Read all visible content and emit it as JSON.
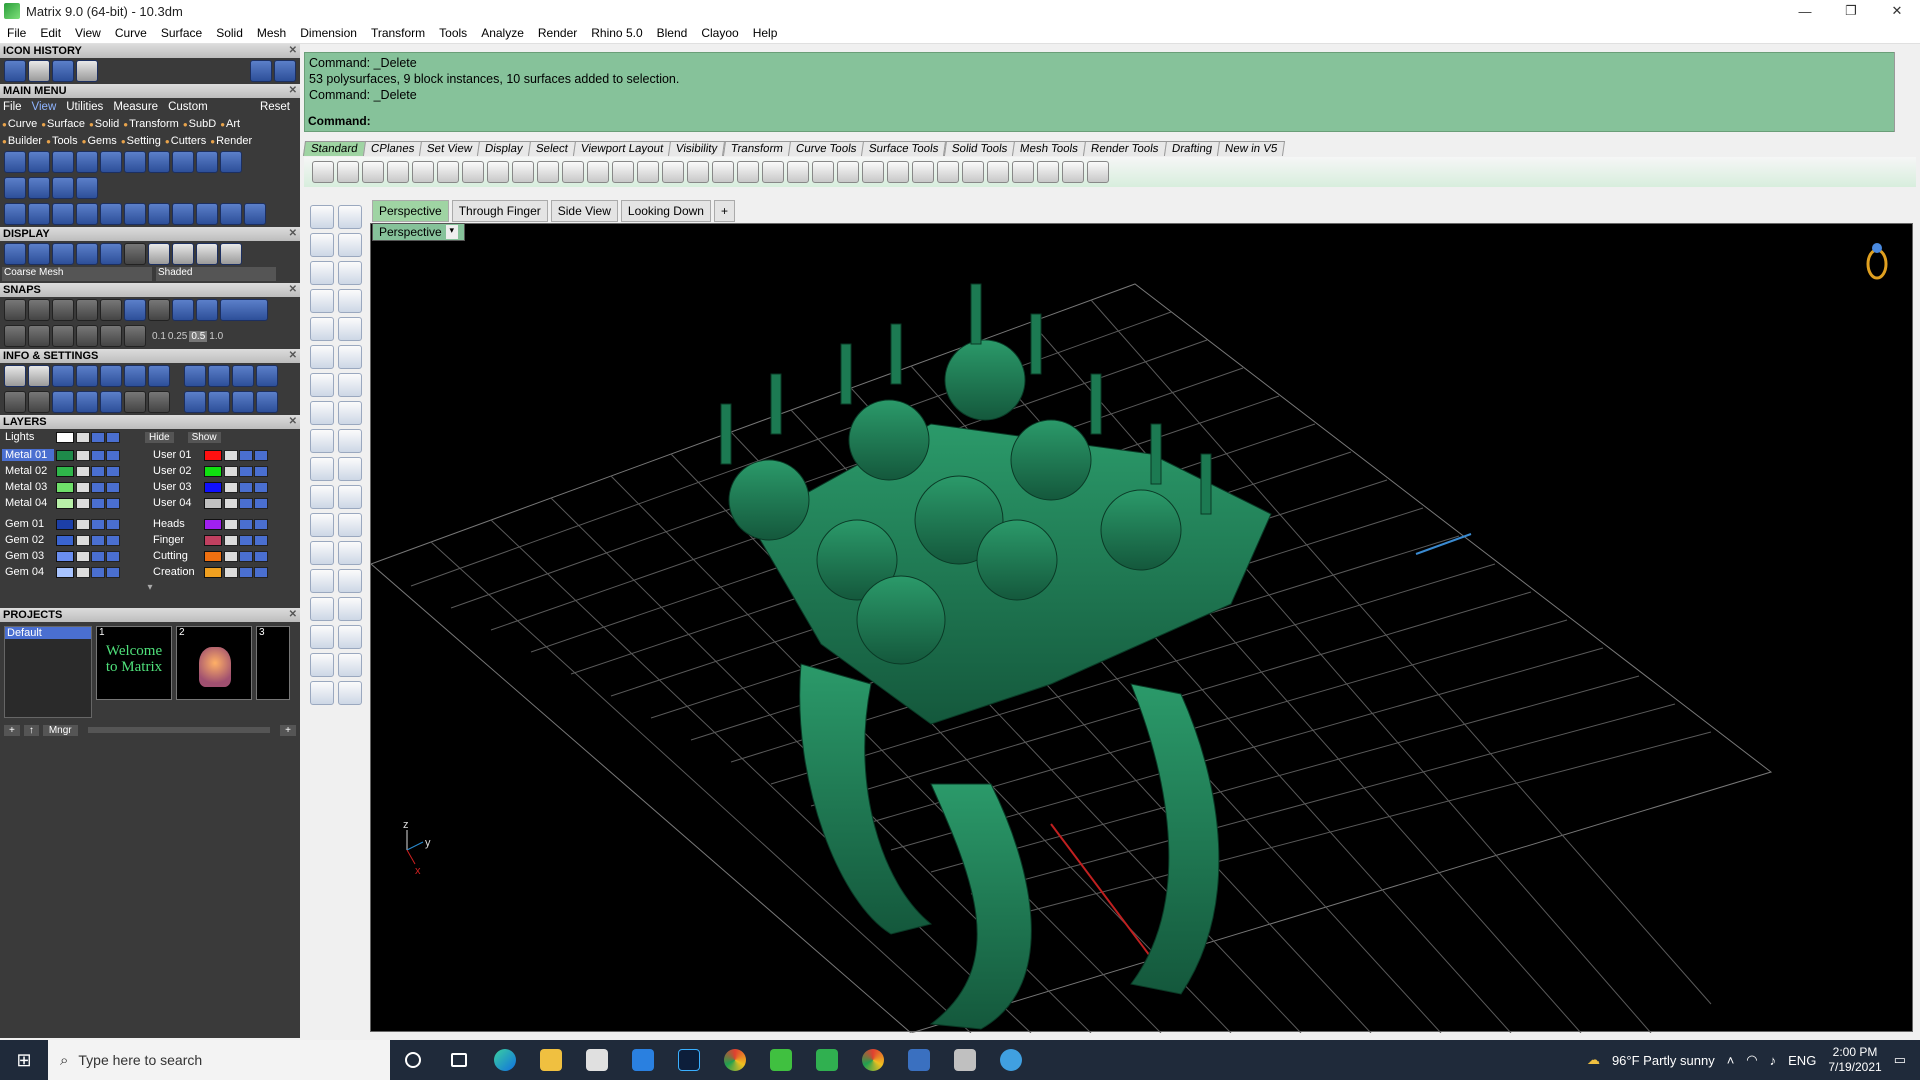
{
  "window": {
    "title": "Matrix 9.0 (64-bit) - 10.3dm",
    "min": "—",
    "max": "❐",
    "close": "✕"
  },
  "menu": [
    "File",
    "Edit",
    "View",
    "Curve",
    "Surface",
    "Solid",
    "Mesh",
    "Dimension",
    "Transform",
    "Tools",
    "Analyze",
    "Render",
    "Rhino 5.0",
    "Blend",
    "Clayoo",
    "Help"
  ],
  "panels": {
    "icon_history": "ICON HISTORY",
    "main_menu": "MAIN MENU",
    "main_menu_row1": [
      "File",
      "View",
      "Utilities",
      "Measure",
      "Custom",
      "Reset"
    ],
    "main_menu_row2": [
      "Curve",
      "Surface",
      "Solid",
      "Transform",
      "SubD",
      "Art"
    ],
    "main_menu_row3": [
      "Builder",
      "Tools",
      "Gems",
      "Setting",
      "Cutters",
      "Render"
    ],
    "display": "DISPLAY",
    "display_mesh": "Coarse Mesh",
    "display_shade": "Shaded",
    "snaps": "SNAPS",
    "snap_values": [
      "0.1",
      "0.25",
      "0.5",
      "1.0"
    ],
    "info": "INFO & SETTINGS",
    "layers": "LAYERS",
    "lights": "Lights",
    "hide": "Hide",
    "show": "Show",
    "layers_left": [
      {
        "name": "Metal 01",
        "color": "#1e8a4a"
      },
      {
        "name": "Metal 02",
        "color": "#2fb64a"
      },
      {
        "name": "Metal 03",
        "color": "#6fe06a"
      },
      {
        "name": "Metal 04",
        "color": "#b8f0a8"
      },
      {
        "name": "Gem 01",
        "color": "#1c3fa8"
      },
      {
        "name": "Gem 02",
        "color": "#3a64d0"
      },
      {
        "name": "Gem 03",
        "color": "#6a8ef0"
      },
      {
        "name": "Gem 04",
        "color": "#a8c4ff"
      }
    ],
    "layers_right": [
      {
        "name": "User 01",
        "color": "#ff1010"
      },
      {
        "name": "User 02",
        "color": "#10e010"
      },
      {
        "name": "User 03",
        "color": "#1010ff"
      },
      {
        "name": "User 04",
        "color": "#c0c0c0"
      },
      {
        "name": "Heads",
        "color": "#a020f0"
      },
      {
        "name": "Finger",
        "color": "#c04060"
      },
      {
        "name": "Cutting",
        "color": "#f07010"
      },
      {
        "name": "Creation",
        "color": "#f0a020"
      }
    ],
    "projects": "PROJECTS",
    "project_default": "Default",
    "thumb1_num": "1",
    "thumb1_text": "Welcome to Matrix",
    "thumb2_num": "2",
    "thumb3_num": "3",
    "mngr": "Mngr"
  },
  "command": {
    "lines": [
      "Command: _Delete",
      "53 polysurfaces, 9 block instances, 10 surfaces added to selection.",
      "Command: _Delete"
    ],
    "prompt": "Command:"
  },
  "tabs": [
    "Standard",
    "CPlanes",
    "Set View",
    "Display",
    "Select",
    "Viewport Layout",
    "Visibility",
    "Transform",
    "Curve Tools",
    "Surface Tools",
    "Solid Tools",
    "Mesh Tools",
    "Render Tools",
    "Drafting",
    "New in V5"
  ],
  "viewport_tabs": [
    "Perspective",
    "Through Finger",
    "Side View",
    "Looking Down",
    "+"
  ],
  "viewport_label": "Perspective",
  "axis": {
    "z": "z",
    "y": "y",
    "x": "x"
  },
  "taskbar": {
    "search": "Type here to search",
    "weather": "96°F  Partly sunny",
    "lang": "ENG",
    "time": "2:00 PM",
    "date": "7/19/2021"
  },
  "colors": {
    "model": "#1e7a55",
    "accent": "#86c29a"
  }
}
